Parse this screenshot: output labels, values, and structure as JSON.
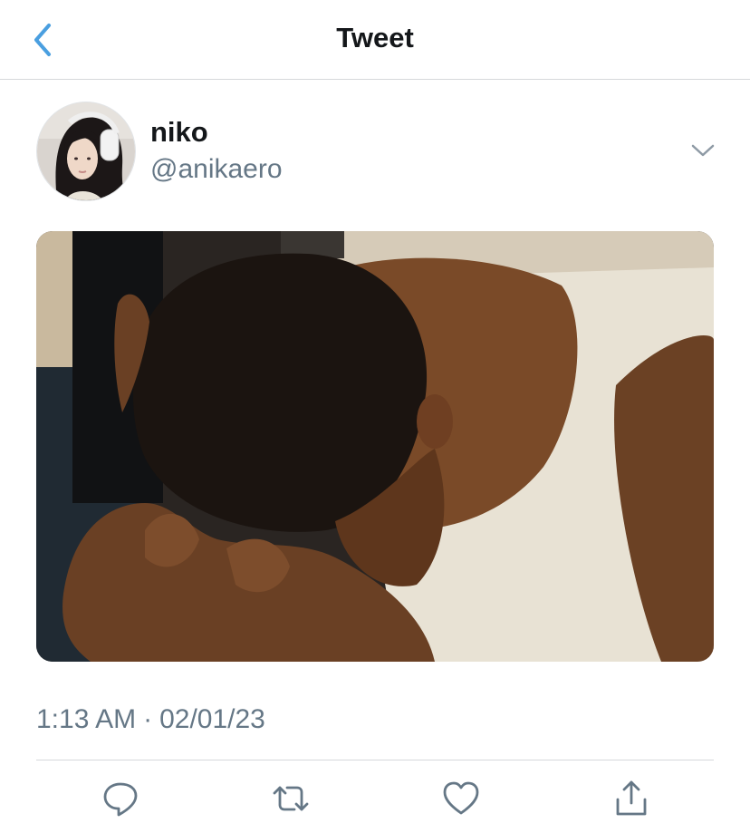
{
  "header": {
    "title": "Tweet",
    "back_icon": "chevron-left-icon",
    "accent_color": "#4a9fe0"
  },
  "tweet": {
    "author": {
      "display_name": "niko",
      "handle": "@anikaero",
      "avatar": "avatar-photo"
    },
    "more_icon": "chevron-down-icon",
    "media": {
      "type": "image",
      "description_icon": "photo-media"
    },
    "time": "1:13 AM",
    "separator": "·",
    "date": "02/01/23"
  },
  "actions": [
    {
      "name": "reply-icon"
    },
    {
      "name": "retweet-icon"
    },
    {
      "name": "like-icon"
    },
    {
      "name": "share-icon"
    }
  ],
  "colors": {
    "text_primary": "#14171a",
    "text_secondary": "#657786",
    "divider": "#d5d8db"
  }
}
